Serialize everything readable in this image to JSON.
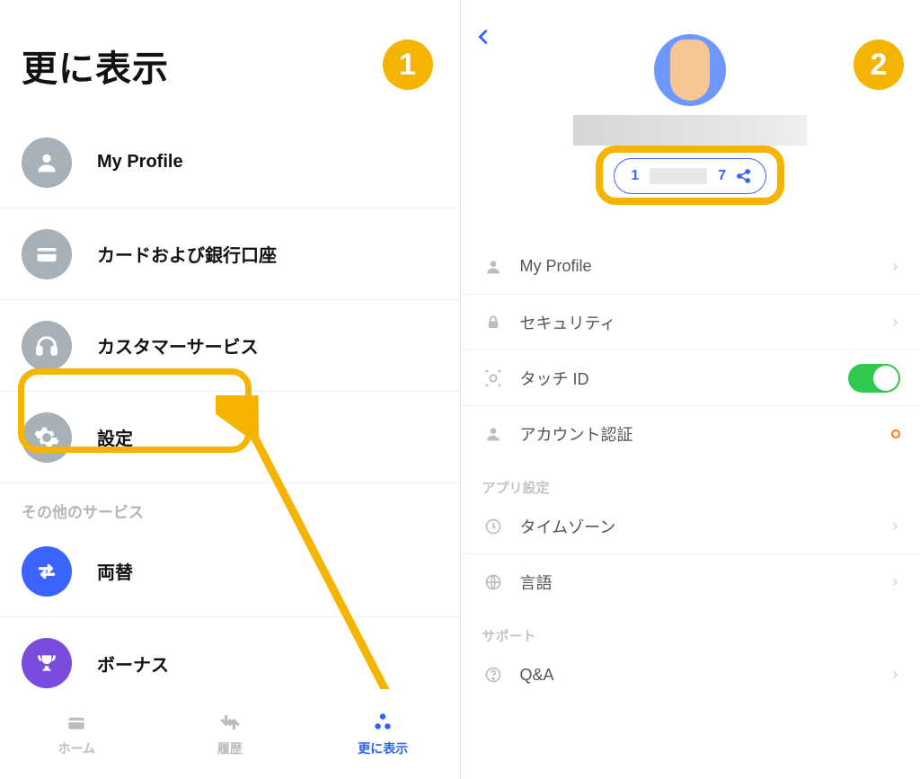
{
  "annotations": {
    "badge1": "1",
    "badge2": "2"
  },
  "left": {
    "title": "更に表示",
    "items": [
      {
        "label": "My Profile",
        "icon": "person"
      },
      {
        "label": "カードおよび銀行口座",
        "icon": "wallet"
      },
      {
        "label": "カスタマーサービス",
        "icon": "headphones"
      },
      {
        "label": "設定",
        "icon": "gear"
      }
    ],
    "section_other": "その他のサービス",
    "other_items": [
      {
        "label": "両替",
        "icon": "swap",
        "bg": "blue"
      },
      {
        "label": "ボーナス",
        "icon": "trophy",
        "bg": "purple"
      }
    ],
    "tabs": {
      "home": "ホーム",
      "history": "履歴",
      "more": "更に表示"
    }
  },
  "right": {
    "back": "‹",
    "id_prefix": "1",
    "id_suffix": "7",
    "items_main": [
      {
        "label": "My Profile",
        "icon": "person",
        "tail": "chev"
      },
      {
        "label": "セキュリティ",
        "icon": "lock",
        "tail": "chev"
      },
      {
        "label": "タッチ ID",
        "icon": "touchid",
        "tail": "switch"
      },
      {
        "label": "アカウント認証",
        "icon": "verify",
        "tail": "alert"
      }
    ],
    "section_app": "アプリ設定",
    "items_app": [
      {
        "label": "タイムゾーン",
        "icon": "clock",
        "tail": "chev"
      },
      {
        "label": "言語",
        "icon": "globe",
        "tail": "chev"
      }
    ],
    "section_support": "サポート",
    "items_support": [
      {
        "label": "Q&A",
        "icon": "help",
        "tail": "chev"
      }
    ]
  }
}
